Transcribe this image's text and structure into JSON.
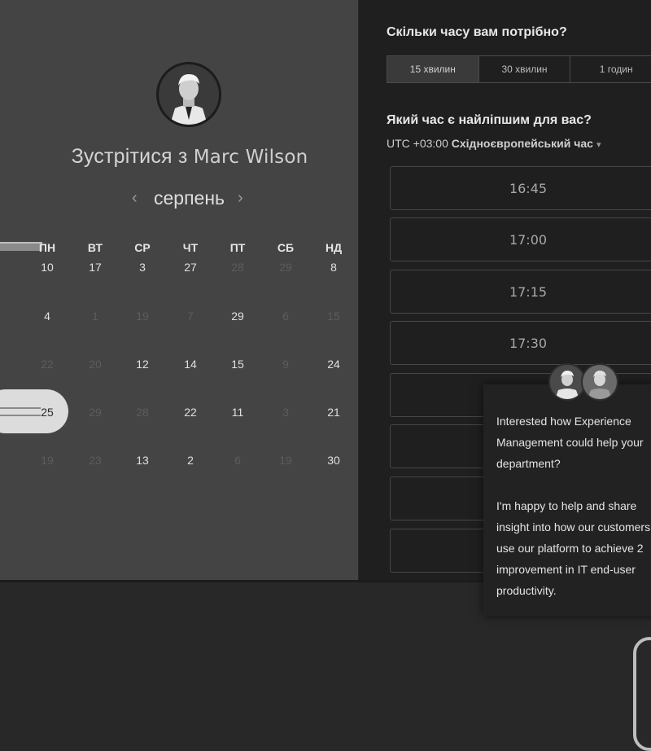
{
  "host": {
    "prefix": "Зустрітися з ",
    "name": "Marc Wilson"
  },
  "calendar": {
    "month": "серпень",
    "prev_icon": "‹",
    "next_icon": "›",
    "weekdays": [
      "ПН",
      "ВТ",
      "СР",
      "ЧТ",
      "ПТ",
      "СБ",
      "НД"
    ],
    "weeks": [
      [
        "10",
        "17",
        "3",
        "27",
        "28",
        "29",
        "8"
      ],
      [
        "4",
        "1",
        "19",
        "7",
        "29",
        "6",
        "15"
      ],
      [
        "22",
        "20",
        "12",
        "14",
        "15",
        "9",
        "24"
      ],
      [
        "25",
        "29",
        "28",
        "22",
        "11",
        "3",
        "21"
      ],
      [
        "19",
        "23",
        "13",
        "2",
        "6",
        "19",
        "30"
      ]
    ],
    "selected_day": "25"
  },
  "duration": {
    "question": "Скільки часу вам потрібно?",
    "options": [
      "15 хвилин",
      "30 хвилин",
      "1 годин"
    ],
    "selected": "15 хвилин"
  },
  "time": {
    "question": "Який час є найліпшим для вас?",
    "timezone_offset": "UTC +03:00 ",
    "timezone_name": "Східноєвропейський час",
    "caret_icon": "▾",
    "slots": [
      "16:45",
      "17:00",
      "17:15",
      "17:30",
      "",
      "",
      ""
    ]
  },
  "chat": {
    "message": "Interested how Experience\nManagement could help your\ndepartment?\n\nI'm happy to help and share\ninsight into how our customers\nuse our platform to achieve 2\nimprovement in IT end-user\nproductivity."
  },
  "colors": {
    "left_panel": "#444444",
    "right_panel": "#1f1f1f",
    "selected_day_bg": "#dcdcdc"
  }
}
